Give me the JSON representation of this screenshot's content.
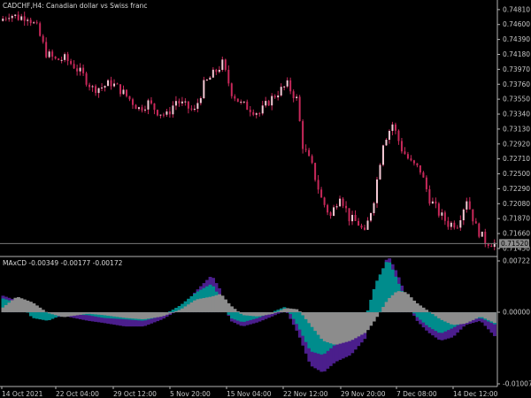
{
  "window": {
    "title": "CADCHF,H4:  Canadian dollar vs Swiss franc"
  },
  "indicator": {
    "title": "MAxCD -0.00349 -0.00177 -0.00172"
  },
  "colors": {
    "background": "#000000",
    "axis": "#b4b4b4",
    "candle_body": "#f4c8d4",
    "candle_wick": "#c8285a",
    "teal": "#008c8c",
    "purple": "#4b1e8c",
    "gray": "#8c8c8c",
    "price_line": "#787878",
    "price_box": "#8c8c8c"
  },
  "chart_data": [
    {
      "type": "candlestick",
      "panel": "main",
      "title": "CADCHF,H4:  Canadian dollar vs Swiss franc",
      "ylim": [
        0.7135,
        0.7492
      ],
      "y_ticks": [
        "0.74810",
        "0.74600",
        "0.74390",
        "0.74180",
        "0.73970",
        "0.73760",
        "0.73550",
        "0.73340",
        "0.73130",
        "0.72920",
        "0.72710",
        "0.72500",
        "0.72290",
        "0.72080",
        "0.71870",
        "0.71660",
        "0.71450"
      ],
      "current_price": "0.71520",
      "close_path": [
        [
          0,
          0.7465
        ],
        [
          3,
          0.7475
        ],
        [
          6,
          0.747
        ],
        [
          9,
          0.7472
        ],
        [
          12,
          0.7455
        ],
        [
          15,
          0.742
        ],
        [
          18,
          0.741
        ],
        [
          21,
          0.7412
        ],
        [
          24,
          0.7402
        ],
        [
          27,
          0.7388
        ],
        [
          30,
          0.737
        ],
        [
          33,
          0.7372
        ],
        [
          36,
          0.7378
        ],
        [
          39,
          0.7368
        ],
        [
          42,
          0.7355
        ],
        [
          45,
          0.7342
        ],
        [
          48,
          0.735
        ],
        [
          51,
          0.7338
        ],
        [
          54,
          0.7332
        ],
        [
          57,
          0.7353
        ],
        [
          60,
          0.7345
        ],
        [
          63,
          0.7338
        ],
        [
          66,
          0.7375
        ],
        [
          69,
          0.739
        ],
        [
          72,
          0.7405
        ],
        [
          75,
          0.7365
        ],
        [
          78,
          0.7348
        ],
        [
          81,
          0.7342
        ],
        [
          84,
          0.7335
        ],
        [
          87,
          0.7352
        ],
        [
          90,
          0.7365
        ],
        [
          93,
          0.7375
        ],
        [
          96,
          0.7355
        ],
        [
          98,
          0.729
        ],
        [
          101,
          0.726
        ],
        [
          104,
          0.7215
        ],
        [
          107,
          0.719
        ],
        [
          110,
          0.7222
        ],
        [
          113,
          0.7188
        ],
        [
          116,
          0.718
        ],
        [
          118,
          0.7165
        ],
        [
          121,
          0.7215
        ],
        [
          124,
          0.7295
        ],
        [
          127,
          0.732
        ],
        [
          130,
          0.7285
        ],
        [
          133,
          0.7265
        ],
        [
          136,
          0.7255
        ],
        [
          139,
          0.7215
        ],
        [
          142,
          0.7195
        ],
        [
          145,
          0.718
        ],
        [
          148,
          0.718
        ],
        [
          151,
          0.7215
        ],
        [
          154,
          0.7175
        ],
        [
          157,
          0.7155
        ],
        [
          160,
          0.7152
        ]
      ]
    },
    {
      "type": "histogram",
      "panel": "indicator",
      "title": "MAxCD -0.00349 -0.00177 -0.00172",
      "ylim": [
        -0.01007,
        0.00722
      ],
      "y_ticks": [
        "0.00722",
        "0.00000",
        "-0.01007"
      ],
      "x_ticks": [
        "14 Oct 2021",
        "22 Oct 04:00",
        "29 Oct 12:00",
        "5 Nov 20:00",
        "15 Nov 04:00",
        "22 Nov 12:00",
        "29 Nov 20:00",
        "7 Dec 08:00",
        "14 Dec 12:00"
      ],
      "series": [
        {
          "name": "teal",
          "path": [
            [
              0,
              0.002
            ],
            [
              6,
              0.0012
            ],
            [
              10,
              -0.0008
            ],
            [
              15,
              -0.0012
            ],
            [
              20,
              -0.0003
            ],
            [
              28,
              -0.0004
            ],
            [
              33,
              -0.0008
            ],
            [
              40,
              -0.001
            ],
            [
              46,
              -0.0012
            ],
            [
              52,
              -0.0005
            ],
            [
              58,
              0.001
            ],
            [
              63,
              0.0028
            ],
            [
              68,
              0.004
            ],
            [
              71,
              0.0018
            ],
            [
              74,
              -0.0008
            ],
            [
              78,
              -0.0014
            ],
            [
              83,
              -0.0008
            ],
            [
              88,
              0.0001
            ],
            [
              92,
              0.0008
            ],
            [
              96,
              -0.002
            ],
            [
              100,
              -0.0055
            ],
            [
              104,
              -0.006
            ],
            [
              108,
              -0.0045
            ],
            [
              113,
              -0.0035
            ],
            [
              118,
              -0.0005
            ],
            [
              121,
              0.004
            ],
            [
              125,
              0.0075
            ],
            [
              128,
              0.0045
            ],
            [
              131,
              0.0015
            ],
            [
              134,
              -0.0005
            ],
            [
              138,
              -0.002
            ],
            [
              142,
              -0.003
            ],
            [
              146,
              -0.0022
            ],
            [
              150,
              -0.0012
            ],
            [
              155,
              -0.0008
            ],
            [
              160,
              -0.0018
            ]
          ]
        },
        {
          "name": "purple",
          "path": [
            [
              0,
              0.0024
            ],
            [
              6,
              0.0015
            ],
            [
              10,
              -0.0005
            ],
            [
              15,
              -0.001
            ],
            [
              20,
              -0.0005
            ],
            [
              28,
              -0.0012
            ],
            [
              33,
              -0.0015
            ],
            [
              40,
              -0.002
            ],
            [
              46,
              -0.002
            ],
            [
              52,
              -0.001
            ],
            [
              58,
              0.0005
            ],
            [
              63,
              0.003
            ],
            [
              68,
              0.0052
            ],
            [
              71,
              0.003
            ],
            [
              74,
              -0.0012
            ],
            [
              78,
              -0.002
            ],
            [
              83,
              -0.0014
            ],
            [
              88,
              -0.0005
            ],
            [
              92,
              0.0003
            ],
            [
              96,
              -0.003
            ],
            [
              100,
              -0.0075
            ],
            [
              104,
              -0.0085
            ],
            [
              108,
              -0.007
            ],
            [
              113,
              -0.006
            ],
            [
              118,
              -0.0035
            ],
            [
              121,
              0.003
            ],
            [
              125,
              0.008
            ],
            [
              128,
              0.0055
            ],
            [
              131,
              0.002
            ],
            [
              134,
              -0.001
            ],
            [
              138,
              -0.0028
            ],
            [
              142,
              -0.004
            ],
            [
              146,
              -0.0035
            ],
            [
              150,
              -0.0018
            ],
            [
              155,
              -0.0012
            ],
            [
              160,
              -0.0036
            ]
          ]
        },
        {
          "name": "gray",
          "path": [
            [
              0,
              0.0005
            ],
            [
              5,
              0.0022
            ],
            [
              10,
              0.0014
            ],
            [
              15,
              -0.0001
            ],
            [
              20,
              -0.0007
            ],
            [
              28,
              -0.0002
            ],
            [
              33,
              -0.0004
            ],
            [
              40,
              -0.0008
            ],
            [
              46,
              -0.001
            ],
            [
              52,
              -0.0006
            ],
            [
              58,
              0.0004
            ],
            [
              63,
              0.0018
            ],
            [
              68,
              0.0022
            ],
            [
              71,
              0.0026
            ],
            [
              74,
              0.001
            ],
            [
              78,
              -0.0004
            ],
            [
              83,
              -0.0006
            ],
            [
              88,
              -0.0002
            ],
            [
              92,
              0.0006
            ],
            [
              96,
              0.0004
            ],
            [
              100,
              -0.0018
            ],
            [
              104,
              -0.004
            ],
            [
              108,
              -0.0046
            ],
            [
              113,
              -0.004
            ],
            [
              118,
              -0.0028
            ],
            [
              121,
              -0.001
            ],
            [
              125,
              0.0018
            ],
            [
              128,
              0.003
            ],
            [
              131,
              0.0028
            ],
            [
              134,
              0.0014
            ],
            [
              138,
              0.0002
            ],
            [
              142,
              -0.001
            ],
            [
              146,
              -0.0018
            ],
            [
              150,
              -0.0016
            ],
            [
              155,
              -0.0006
            ],
            [
              160,
              -0.0016
            ]
          ]
        }
      ]
    }
  ]
}
